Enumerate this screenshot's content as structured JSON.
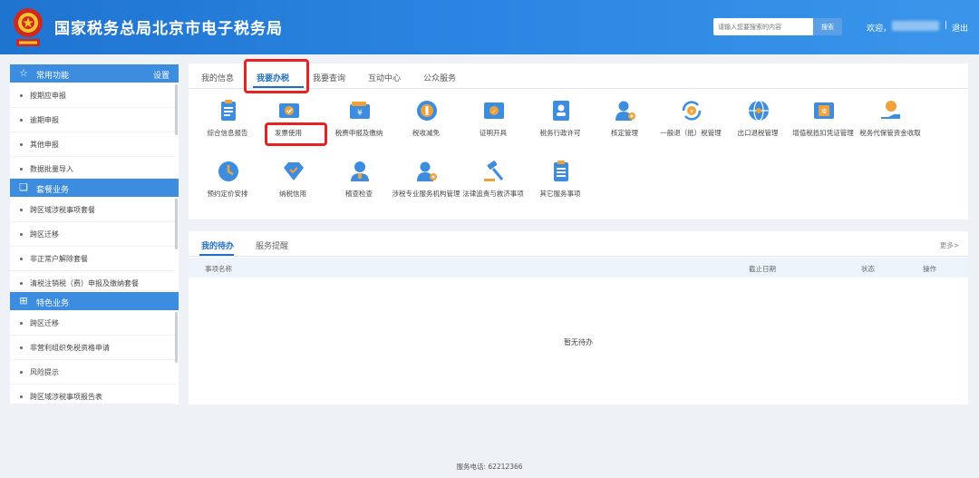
{
  "header": {
    "title": "国家税务总局北京市电子税务局",
    "search_placeholder": "请输入您要搜索的内容",
    "search_label": "搜索",
    "welcome": "欢迎，",
    "separator": "|",
    "logout": "退出"
  },
  "sidebar": {
    "sections": [
      {
        "title": "常用功能",
        "icon": "star-icon",
        "settings": "设置",
        "items": [
          "按期应申报",
          "逾期申报",
          "其他申报",
          "数据批量导入"
        ]
      },
      {
        "title": "套餐业务",
        "icon": "box-icon",
        "items": [
          "跨区域涉税事项套餐",
          "跨区迁移",
          "非正常户解除套餐",
          "清税注销税（费）申报及缴纳套餐"
        ]
      },
      {
        "title": "特色业务",
        "icon": "grid-icon",
        "items": [
          "跨区迁移",
          "非营利组织免税资格申请",
          "风险提示",
          "跨区域涉税事项报告表"
        ]
      }
    ]
  },
  "tabs": [
    "我的信息",
    "我要办税",
    "我要查询",
    "互动中心",
    "公众服务"
  ],
  "active_tab": "我要办税",
  "services": [
    "综合信息报告",
    "发票使用",
    "税费申报及缴纳",
    "税收减免",
    "证明开具",
    "税务行政许可",
    "核定管理",
    "一般退（抵）税管理",
    "出口退税管理",
    "增值税抵扣凭证管理",
    "税务代保管资金收取",
    "预约定价安排",
    "纳税信用",
    "稽查检查",
    "涉税专业服务机构管理",
    "法律追责与救济事项",
    "其它服务事项"
  ],
  "todo": {
    "tabs": [
      "我的待办",
      "服务提醒"
    ],
    "more": "更多>",
    "columns": [
      "事项名称",
      "截止日期",
      "状态",
      "操作"
    ],
    "empty": "暂无待办"
  },
  "footer": "服务电话: 62212366",
  "colors": {
    "header_blue": "#2a86e2",
    "accent_blue": "#3c8de0",
    "highlight_red": "#e52422"
  }
}
